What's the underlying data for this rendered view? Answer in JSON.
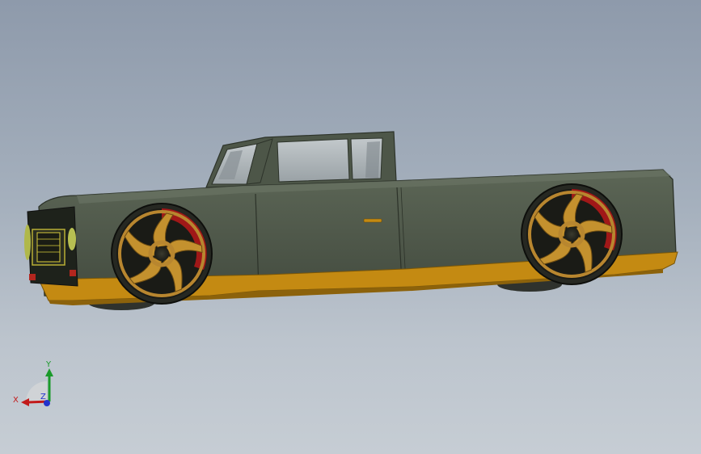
{
  "viewport": {
    "background_top": "#8e9aab",
    "background_bottom": "#c6cdd4"
  },
  "model": {
    "body_color": "#4b5446",
    "rocker_color": "#c48a12",
    "wheel_color": "#b8862f",
    "wheel_accent": "#a01818",
    "glass_color": "#a9b0b4"
  },
  "triad": {
    "x_label": "X",
    "y_label": "Y",
    "z_label": "Z",
    "x_color": "#c21a1a",
    "y_color": "#1a9a2a",
    "z_color": "#2233cc"
  }
}
